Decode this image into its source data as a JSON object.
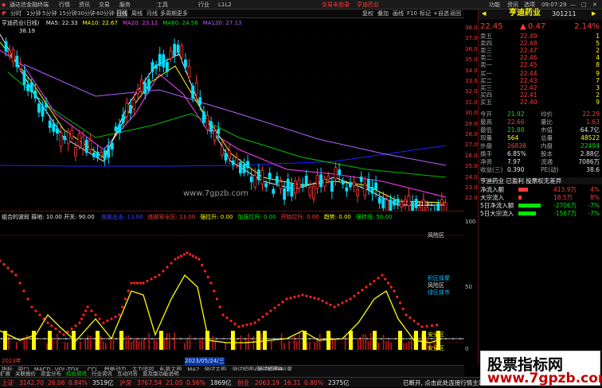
{
  "titlebar": {
    "app_title": "通达信金融终端",
    "menus": [
      "行情",
      "资讯",
      "交易",
      "服务",
      "工具",
      "行业",
      "L1L2"
    ],
    "notice": "交易未登录",
    "stock_label": "亨迪药业",
    "right_menus": [
      "功能",
      "资讯",
      "选项"
    ],
    "time": "09:07:29"
  },
  "toolbar": {
    "periods": [
      "分时",
      "1分钟",
      "5分钟",
      "15分钟",
      "30分钟",
      "60分钟",
      "日线",
      "周线",
      "月线",
      "多周期",
      "更多"
    ],
    "active": "日线",
    "right_tools": [
      "复权",
      "叠加",
      "画线",
      "F10",
      "标记",
      "+自选",
      "返回"
    ]
  },
  "main_legend": {
    "stock": "亨迪药业(日线)",
    "items": [
      {
        "label": "MA5: 22.33",
        "color": "#e8e8e8"
      },
      {
        "label": "MA10: 22.67",
        "color": "#ffff00"
      },
      {
        "label": "MA20: 23.12",
        "color": "#ff40ff"
      },
      {
        "label": "MA60: 24.56",
        "color": "#00e600"
      },
      {
        "label": "MA120: 27.13",
        "color": "#b060ff"
      }
    ]
  },
  "price_labels": {
    "high": "38.19",
    "low": "21.81"
  },
  "chart_watermark": "www.7gpzb.com",
  "price_axis": [
    "38.00",
    "37.00",
    "36.00",
    "35.00",
    "34.00",
    "33.00",
    "32.00",
    "31.00",
    "30.00",
    "29.00",
    "28.00",
    "27.00",
    "26.00",
    "25.00",
    "24.00",
    "23.00",
    "22.00"
  ],
  "indicator": {
    "title": "组合的波段",
    "params": "薛地: 10.00  开关: 90.00",
    "items": [
      {
        "label": "底部出击: 13.00",
        "color": "#4040ff"
      },
      {
        "label": "底部安全区: 13.00",
        "color": "#ff3b3b"
      },
      {
        "label": "强拉升: 0.00",
        "color": "#ffff00"
      },
      {
        "label": "加强拉升: 0.00",
        "color": "#00e600"
      },
      {
        "label": "开始拉升: 0.00",
        "color": "#ff3b3b"
      },
      {
        "label": "趋势: 0.00",
        "color": "#ffff00"
      },
      {
        "label": "强转线: 50.00",
        "color": "#00e600"
      }
    ],
    "zone_labels": [
      "风险区",
      "积区择聚",
      "风险区",
      "绿区择市",
      "安全区",
      "安全区"
    ],
    "bottom_labels": [
      "2023年",
      "2023/05/24/三"
    ]
  },
  "ind_axis": [
    "100",
    "50",
    "0"
  ],
  "quote": {
    "name": "亨迪药业",
    "code": "301211",
    "price": "22.45",
    "change": "0.47",
    "pct": "2.14%",
    "sell": [
      {
        "label": "卖五",
        "price": "22.49",
        "vol": "1"
      },
      {
        "label": "卖四",
        "price": "22.48",
        "vol": "5"
      },
      {
        "label": "卖三",
        "price": "22.47",
        "vol": "2"
      },
      {
        "label": "卖二",
        "price": "22.46",
        "vol": "4"
      },
      {
        "label": "卖一",
        "price": "22.45",
        "vol": "8"
      }
    ],
    "buy": [
      {
        "label": "买一",
        "price": "22.44",
        "vol": "9"
      },
      {
        "label": "买二",
        "price": "22.43",
        "vol": "7"
      },
      {
        "label": "买三",
        "price": "22.42",
        "vol": "3"
      },
      {
        "label": "买四",
        "price": "22.41",
        "vol": "2"
      },
      {
        "label": "买五",
        "price": "22.40",
        "vol": "9"
      }
    ],
    "stats": [
      {
        "k1": "今开",
        "v1": "21.92",
        "k2": "均价",
        "v2": "22.29",
        "c1": "green",
        "c2": "red"
      },
      {
        "k1": "最高",
        "v1": "22.66",
        "k2": "量比",
        "v2": "1.63",
        "c1": "red",
        "c2": "red"
      },
      {
        "k1": "最低",
        "v1": "21.88",
        "k2": "市值",
        "v2": "64.7亿",
        "c1": "green",
        "c2": "white"
      },
      {
        "k1": "现量",
        "v1": "564",
        "k2": "总量",
        "v2": "48522",
        "c1": "yel",
        "c2": "yel"
      },
      {
        "k1": "外盘",
        "v1": "26838",
        "k2": "内盘",
        "v2": "22484",
        "c1": "red",
        "c2": "green"
      },
      {
        "k1": "换手",
        "v1": "6.85%",
        "k2": "股本",
        "v2": "2.88亿",
        "c1": "white",
        "c2": "white"
      },
      {
        "k1": "净资",
        "v1": "7.97",
        "k2": "流通",
        "v2": "7086万",
        "c1": "white",
        "c2": "white"
      },
      {
        "k1": "收益(三)",
        "v1": "0.390",
        "k2": "PE(动)",
        "v2": "38.6",
        "c1": "white",
        "c2": "white"
      }
    ],
    "profile": "亨迪药业  已盈利  投票权无差异",
    "flows": [
      {
        "label": "净流入额",
        "value": "413.9万",
        "pct": "4%",
        "color": "#ff3b3b",
        "bar": 0.3
      },
      {
        "label": "大宗流入",
        "value": "18.5万",
        "pct": "8%",
        "color": "#ff3b3b",
        "bar": 0.1
      },
      {
        "label": "5日净流入额",
        "value": "-2706万",
        "pct": "-7%",
        "color": "#00e600",
        "bar": 0.7
      },
      {
        "label": "5日大宗流入",
        "value": "-1567万",
        "pct": "-7%",
        "color": "#00e600",
        "bar": 0.55
      }
    ],
    "rtab": "日线"
  },
  "tabs": [
    "指标",
    "窗口",
    "MACD",
    "VOL-TDX",
    "CCI",
    "趋势动力",
    "主力监控",
    "私募主图",
    "MA2",
    "测试主图",
    "测试幅图A",
    "测试幅图B",
    "设置"
  ],
  "tabs_active": "测试幅图B",
  "subtabs": [
    "扩展",
    "关联报价",
    "资金分布",
    "综合资讯",
    "行业资讯",
    "互动问答",
    "普及版功能说明"
  ],
  "status": [
    {
      "name": "上证",
      "val": "3142.70",
      "chg": "26.06",
      "pct": "0.84%",
      "vol": "3519亿"
    },
    {
      "name": "沪深",
      "val": "3767.54",
      "chg": "21.05",
      "pct": "0.56%",
      "vol": "1869亿"
    },
    {
      "name": "创业",
      "val": "2063.19",
      "chg": "16.31",
      "pct": "0.80%",
      "vol": "2375亿"
    }
  ],
  "status_right": "已断开, 点击此处连接行情主站",
  "wm": {
    "line1": "股票指标网",
    "line2": "www.7gpzb.com"
  }
}
